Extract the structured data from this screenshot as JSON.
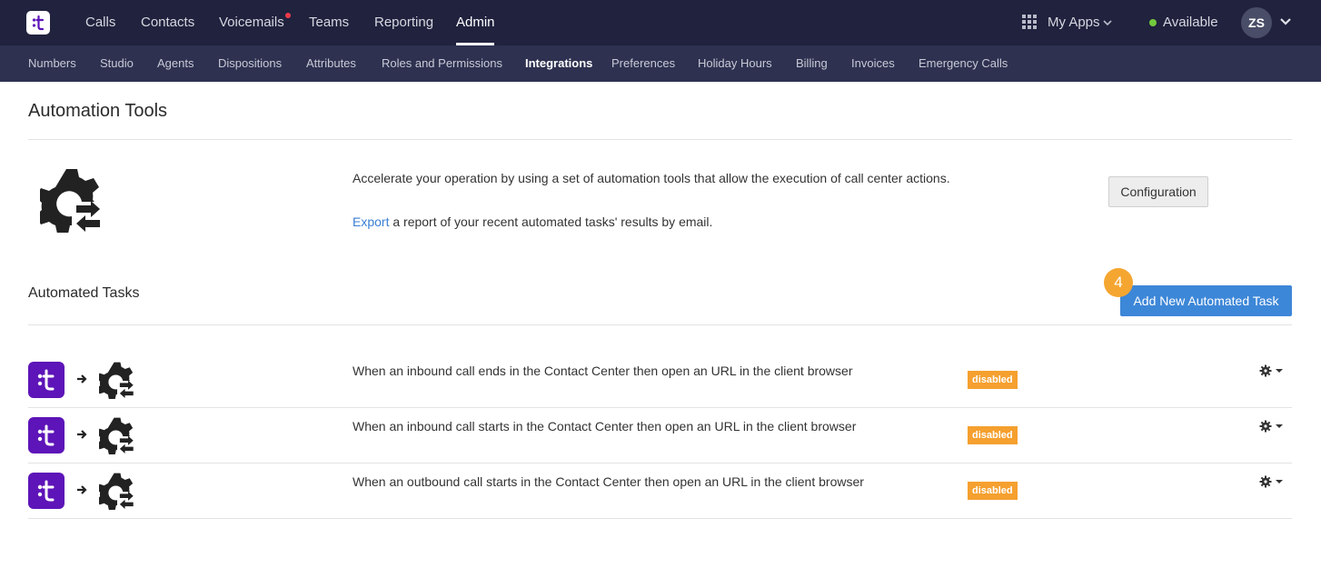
{
  "topnav": {
    "items": [
      {
        "label": "Calls"
      },
      {
        "label": "Contacts"
      },
      {
        "label": "Voicemails"
      },
      {
        "label": "Teams"
      },
      {
        "label": "Reporting"
      },
      {
        "label": "Admin"
      }
    ],
    "active": "Admin",
    "my_apps_label": "My Apps",
    "status_label": "Available",
    "avatar_initials": "ZS"
  },
  "subnav": {
    "items": [
      {
        "label": "Numbers"
      },
      {
        "label": "Studio"
      },
      {
        "label": "Agents"
      },
      {
        "label": "Dispositions"
      },
      {
        "label": "Attributes"
      },
      {
        "label": "Roles and Permissions"
      },
      {
        "label": "Integrations"
      },
      {
        "label": "Preferences"
      },
      {
        "label": "Holiday Hours"
      },
      {
        "label": "Billing"
      },
      {
        "label": "Invoices"
      },
      {
        "label": "Emergency Calls"
      }
    ],
    "active": "Integrations"
  },
  "page": {
    "title": "Automation Tools",
    "description": "Accelerate your operation by using a set of automation tools that allow the execution of call center actions.",
    "export_link": "Export",
    "export_rest": " a report of your recent automated tasks' results by email.",
    "configuration_button": "Configuration"
  },
  "tasks_section": {
    "title": "Automated Tasks",
    "add_button": "Add New Automated Task",
    "step_badge": "4",
    "rows": [
      {
        "text": "When an inbound call ends in the Contact Center then open an URL in the client browser",
        "status": "disabled"
      },
      {
        "text": "When an inbound call starts in the Contact Center then open an URL in the client browser",
        "status": "disabled"
      },
      {
        "text": "When an outbound call starts in the Contact Center then open an URL in the client browser",
        "status": "disabled"
      }
    ]
  },
  "colors": {
    "topbar": "#20223e",
    "subbar": "#2e3150",
    "accent_blue": "#3d87d8",
    "badge_orange": "#f5a02f",
    "app_purple": "#5d14b8",
    "status_green": "#73c93c"
  },
  "icons": {
    "logo": "talkdesk-logo-icon",
    "apps": "grid-icon",
    "automation": "gear-arrows-icon",
    "row_settings": "gear-dropdown-icon"
  }
}
